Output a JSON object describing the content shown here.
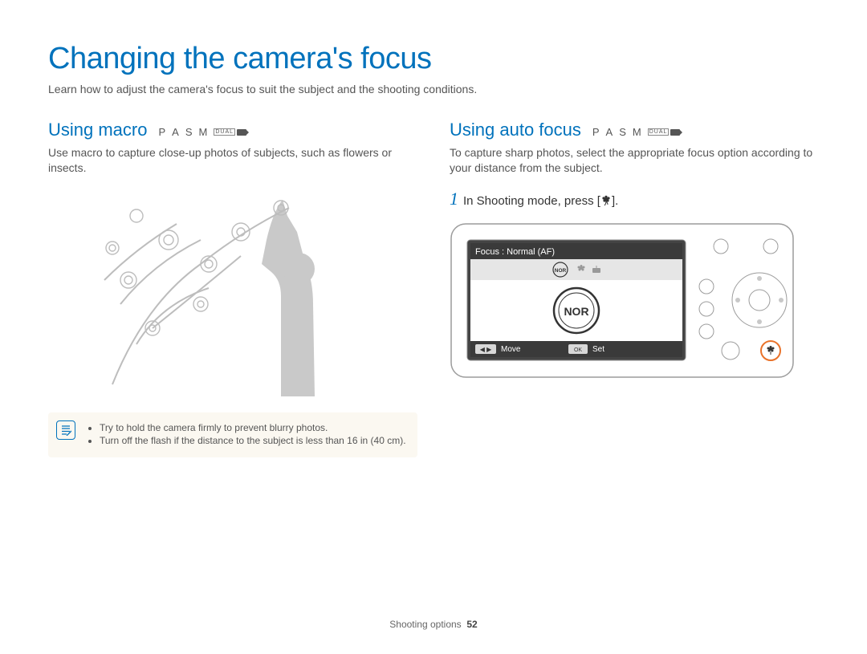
{
  "title": "Changing the camera's focus",
  "intro": "Learn how to adjust the camera's focus to suit the subject and the shooting conditions.",
  "left": {
    "heading": "Using macro",
    "modes": [
      "P",
      "A",
      "S",
      "M"
    ],
    "dual_label": "DUAL",
    "body": "Use macro to capture close-up photos of subjects, such as flowers or insects.",
    "tips": [
      "Try to hold the camera firmly to prevent blurry photos.",
      "Turn off the flash if the distance to the subject is less than 16 in (40 cm)."
    ]
  },
  "right": {
    "heading": "Using auto focus",
    "modes": [
      "P",
      "A",
      "S",
      "M"
    ],
    "dual_label": "DUAL",
    "body": "To capture sharp photos, select the appropriate focus option according to your distance from the subject.",
    "step_num": "1",
    "step_text_prefix": "In Shooting mode, press [",
    "step_text_suffix": "].",
    "screen": {
      "title": "Focus : Normal (AF)",
      "move": "Move",
      "set": "Set",
      "ok": "OK",
      "center_label": "NOR"
    }
  },
  "footer": {
    "section": "Shooting options",
    "page": "52"
  }
}
